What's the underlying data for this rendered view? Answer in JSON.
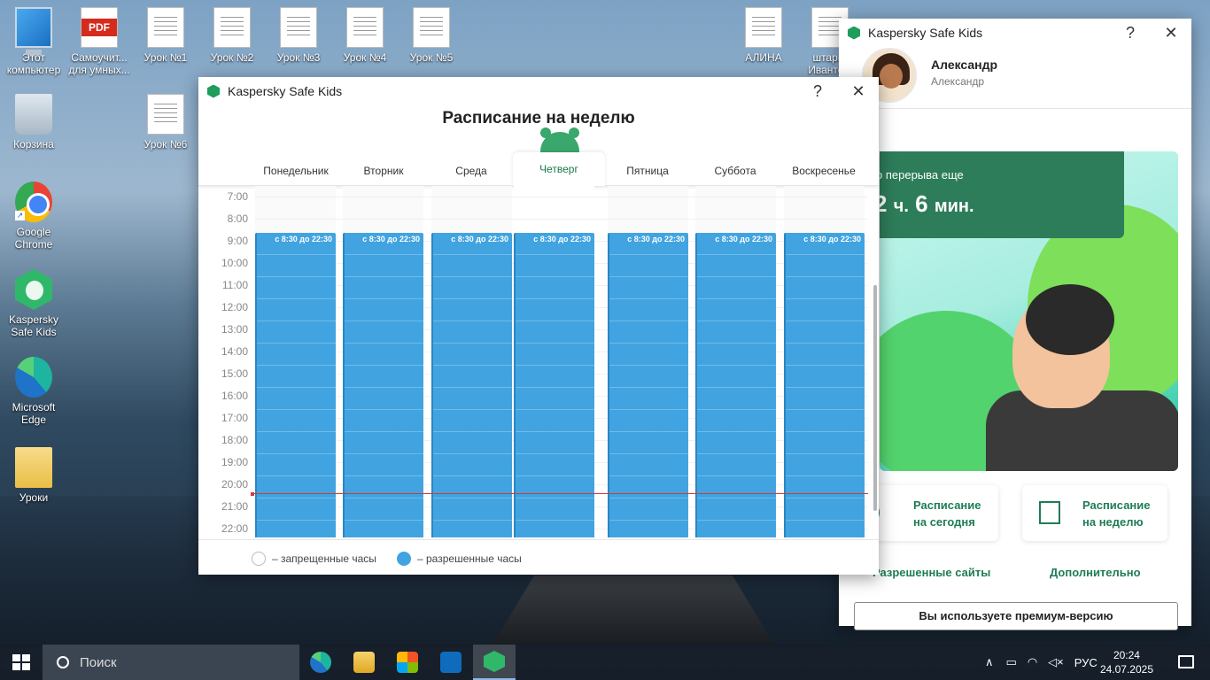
{
  "desktop": {
    "icons": [
      {
        "label": "Этот компьютер"
      },
      {
        "label": "Самоучит... для умных..."
      },
      {
        "label": "Урок №1"
      },
      {
        "label": "Урок №2"
      },
      {
        "label": "Урок №3"
      },
      {
        "label": "Урок №4"
      },
      {
        "label": "Урок №5"
      },
      {
        "label": "Корзина"
      },
      {
        "label": "Урок №6"
      },
      {
        "label": "Google Chrome"
      },
      {
        "label": "Kaspersky Safe Kids"
      },
      {
        "label": "Microsoft Edge"
      },
      {
        "label": "Уроки"
      },
      {
        "label": "АЛИНА"
      },
      {
        "label": "штарга Ивантс..."
      },
      {
        "label": "PDF"
      }
    ]
  },
  "schedule_window": {
    "title": "Kaspersky Safe Kids",
    "help": "?",
    "close": "✕",
    "heading": "Расписание на неделю",
    "days": [
      "Понедельник",
      "Вторник",
      "Среда",
      "Четверг",
      "Пятница",
      "Суббота",
      "Воскресенье"
    ],
    "active_day": "Четверг",
    "hours": [
      "7:00",
      "8:00",
      "9:00",
      "10:00",
      "11:00",
      "12:00",
      "13:00",
      "14:00",
      "15:00",
      "16:00",
      "17:00",
      "18:00",
      "19:00",
      "20:00",
      "21:00",
      "22:00"
    ],
    "bar_label": "с 8:30 до 22:30",
    "legend_forbidden": "– запрещенные часы",
    "legend_allowed": "– разрешенные часы",
    "colors": {
      "allowed": "#41a4e0",
      "forbidden": "#ffffff",
      "now_line": "#d23a3a",
      "accent": "#167a49"
    }
  },
  "main_window": {
    "title": "Kaspersky Safe Kids",
    "help": "?",
    "close": "✕",
    "profile_name": "Александр",
    "profile_sub": "Александр",
    "timer_label": "о перерыва еще",
    "timer_hours": "2",
    "timer_hours_unit": "ч.",
    "timer_minutes": "6",
    "timer_minutes_unit": "мин.",
    "card_today": [
      "Расписание",
      "на сегодня"
    ],
    "card_week": [
      "Расписание",
      "на неделю"
    ],
    "link_sites": "Разрешенные сайты",
    "link_more": "Дополнительно",
    "premium": "Вы используете премиум-версию"
  },
  "taskbar": {
    "search_placeholder": "Поиск",
    "lang": "РУС",
    "time": "20:24",
    "date": "24.07.2025",
    "apps": [
      "edge-icon",
      "file-explorer-icon",
      "store-icon",
      "outlook-icon",
      "kaspersky-icon"
    ]
  }
}
